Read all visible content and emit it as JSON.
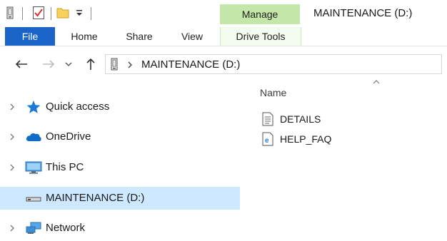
{
  "window": {
    "title": "MAINTENANCE (D:)"
  },
  "context_tab": {
    "label": "Manage"
  },
  "ribbon": {
    "tabs": [
      {
        "label": "File"
      },
      {
        "label": "Home"
      },
      {
        "label": "Share"
      },
      {
        "label": "View"
      },
      {
        "label": "Drive Tools"
      }
    ]
  },
  "address": {
    "path": "MAINTENANCE (D:)"
  },
  "nav_pane": {
    "items": [
      {
        "label": "Quick access",
        "icon": "star-icon"
      },
      {
        "label": "OneDrive",
        "icon": "cloud-icon"
      },
      {
        "label": "This PC",
        "icon": "monitor-icon"
      },
      {
        "label": "MAINTENANCE (D:)",
        "icon": "drive-icon",
        "selected": true
      },
      {
        "label": "Network",
        "icon": "network-icon"
      }
    ]
  },
  "content": {
    "column_header": "Name",
    "files": [
      {
        "name": "DETAILS",
        "icon": "text-file-icon"
      },
      {
        "name": "HELP_FAQ",
        "icon": "html-file-icon"
      }
    ]
  },
  "colors": {
    "file_tab": "#1a64c7",
    "manage_tab": "#c4e6a8",
    "selection": "#cde8ff",
    "accent_blue": "#1f7ad6"
  }
}
